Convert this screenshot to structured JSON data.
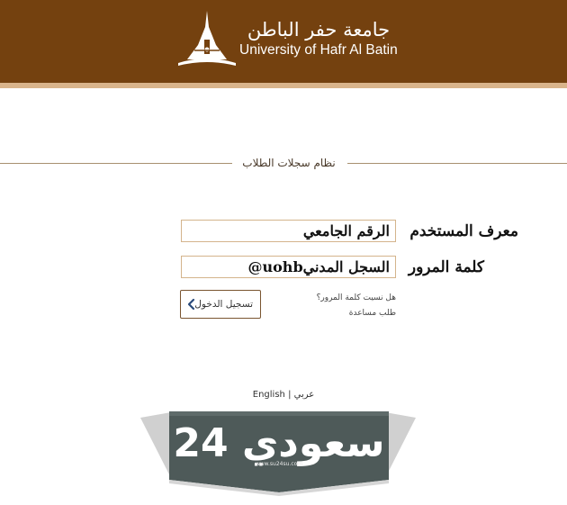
{
  "header": {
    "name_ar": "جامعة حفر الباطن",
    "name_en": "University of Hafr Al Batin"
  },
  "section": {
    "title": "نظام سجلات الطلاب"
  },
  "form": {
    "username_label": "معرف المستخدم",
    "username_value": "الرقم الجامعي",
    "password_label": "كلمة المرور",
    "password_value": "السجل المدنيuohb@",
    "login_button": "تسجيل الدخول",
    "forgot_password": "هل نسيت كلمة المرور؟",
    "request_help": "طلب مساعدة"
  },
  "language": {
    "english": "English",
    "separator": "|",
    "arabic": "عربي"
  },
  "watermark": {
    "text": "سعودي 24",
    "url": "www.su24su.com"
  },
  "colors": {
    "header_bg": "#74410f",
    "header_stripe": "#d9b48b",
    "field_border": "#d4b48c",
    "watermark_bg": "#4e5a59"
  }
}
